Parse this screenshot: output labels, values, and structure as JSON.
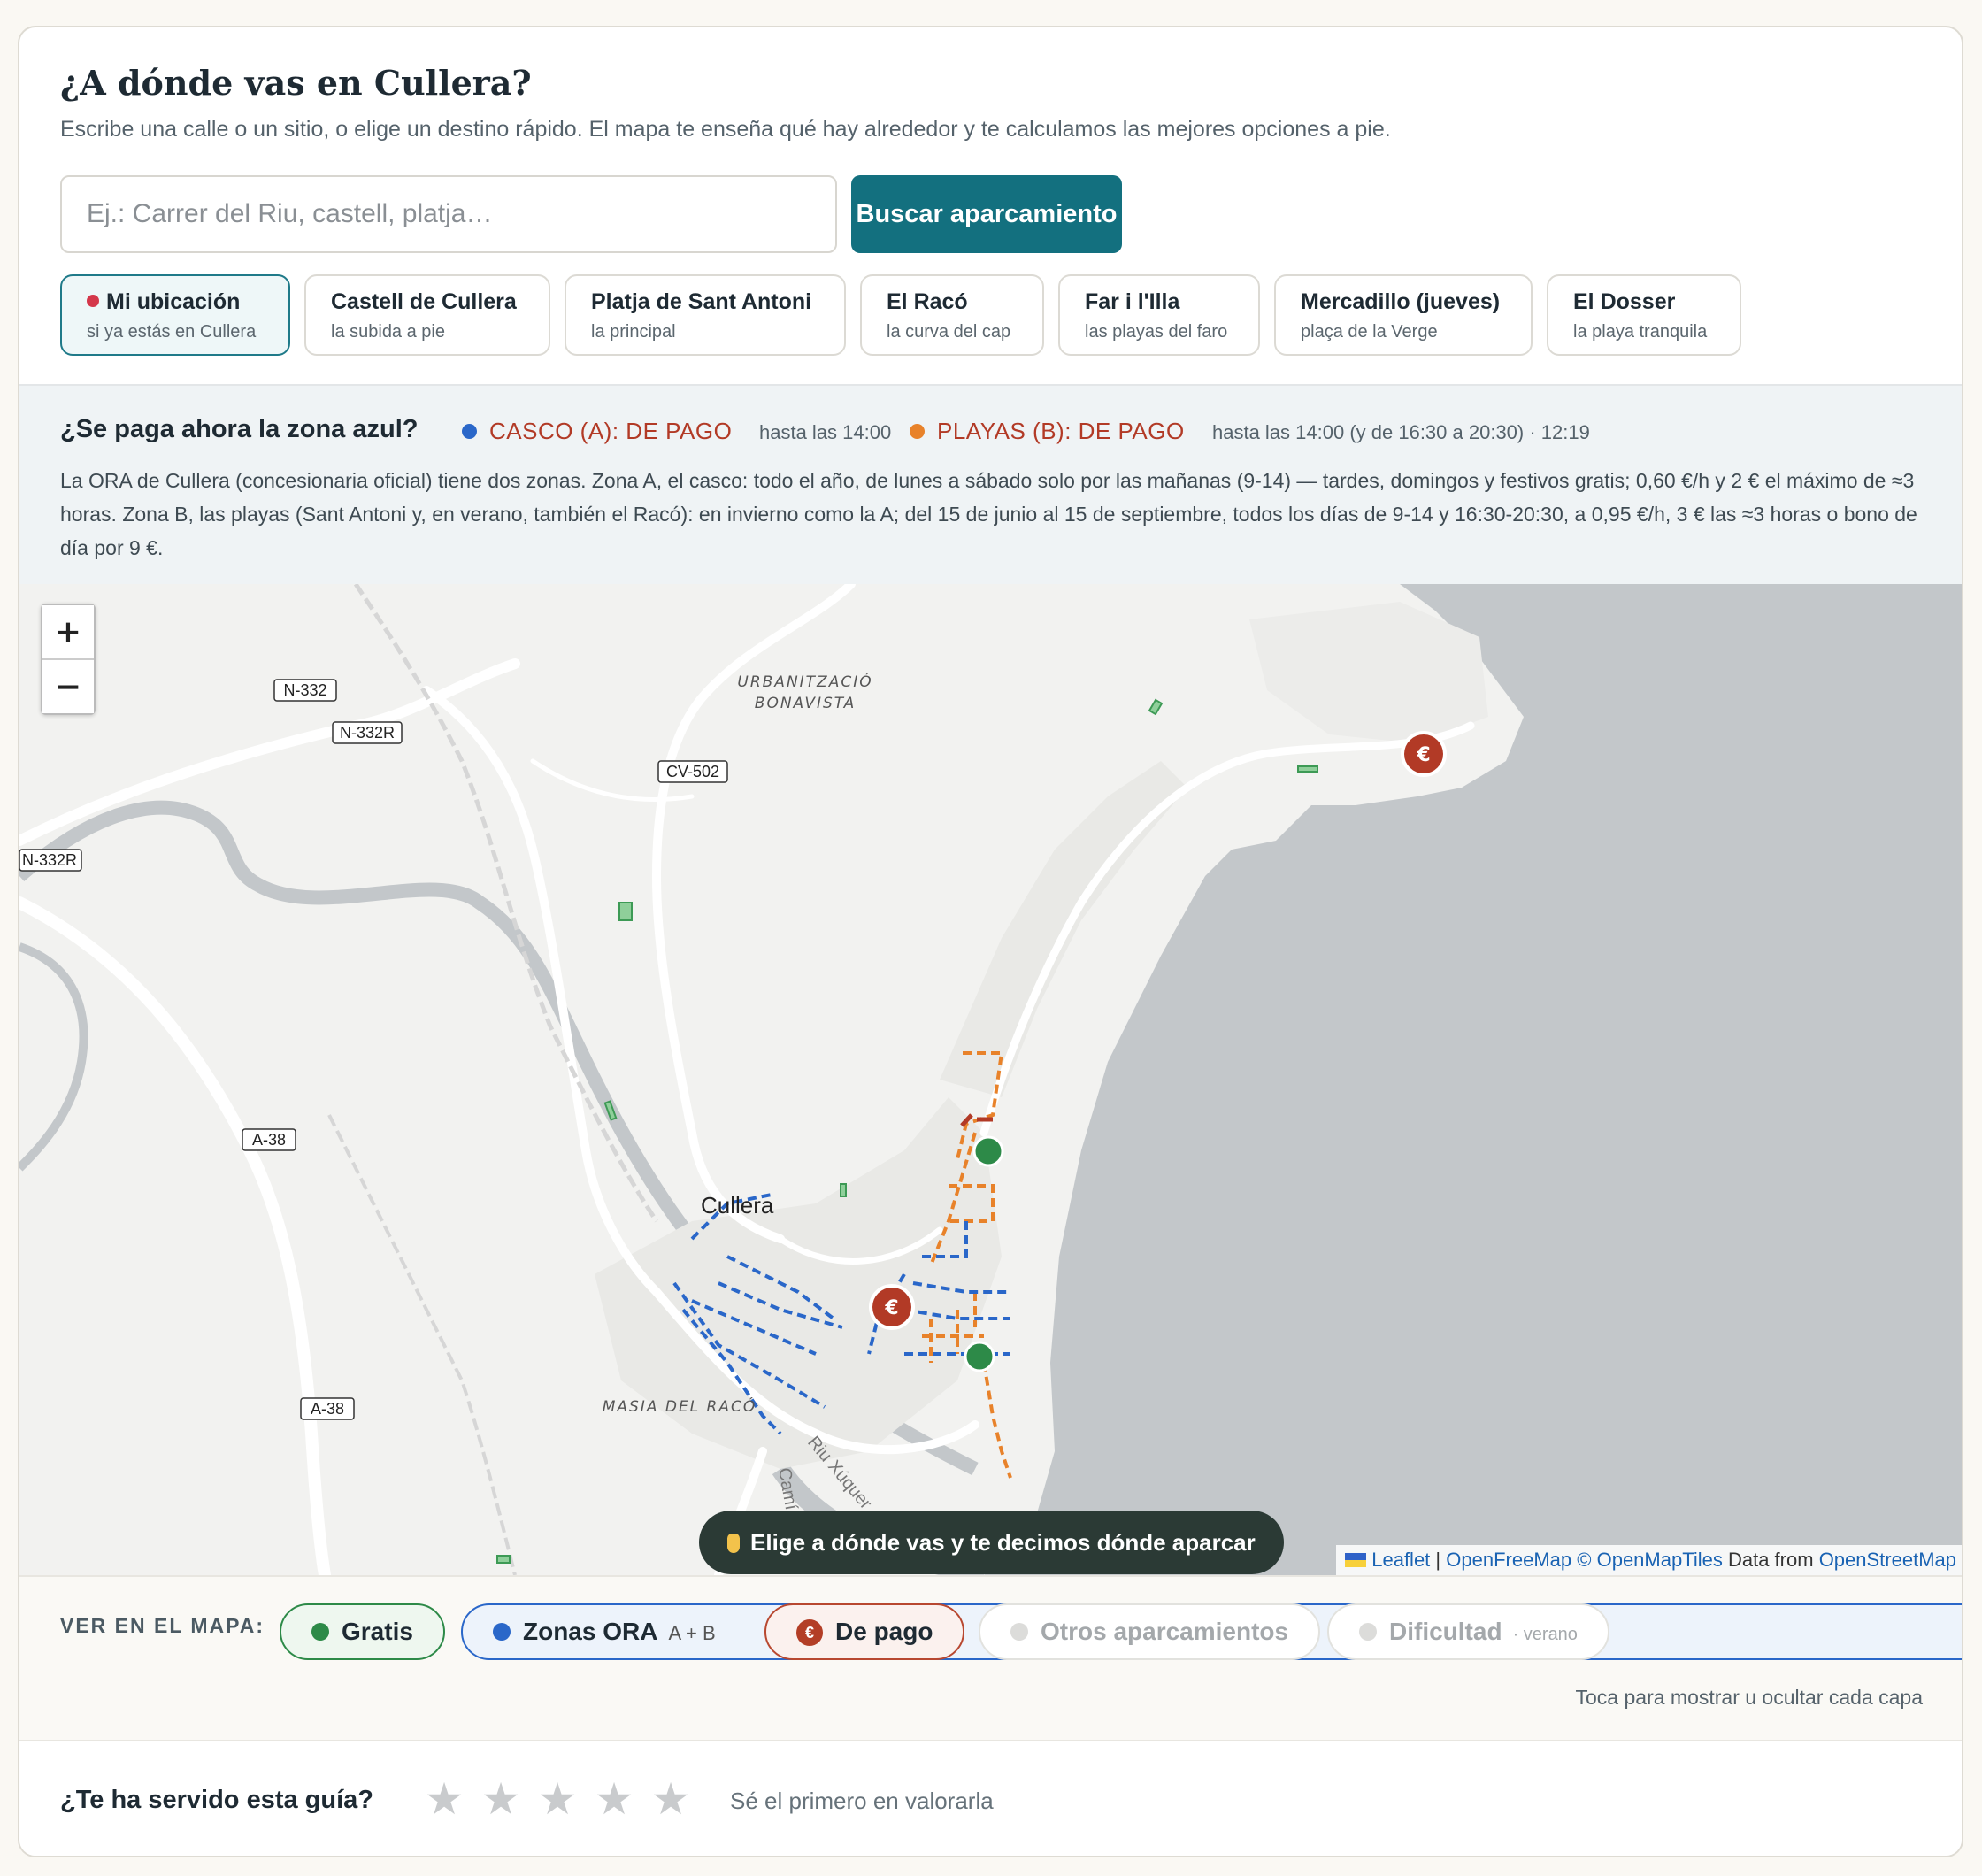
{
  "header": {
    "title": "¿A dónde vas en Cullera?",
    "subtitle": "Escribe una calle o un sitio, o elige un destino rápido. El mapa te enseña qué hay alrededor y te calculamos las mejores opciones a pie.",
    "search_placeholder": "Ej.: Carrer del Riu, castell, platja…",
    "search_value": "",
    "search_button": "Buscar aparcamiento"
  },
  "destinations": [
    {
      "label": "Mi ubicación",
      "sub": "si ya estás en Cullera",
      "icon": "pin-icon"
    },
    {
      "label": "Castell de Cullera",
      "sub": "la subida a pie"
    },
    {
      "label": "Platja de Sant Antoni",
      "sub": "la principal"
    },
    {
      "label": "El Racó",
      "sub": "la curva del cap"
    },
    {
      "label": "Far i l'Illa",
      "sub": "las playas del faro"
    },
    {
      "label": "Mercadillo (jueves)",
      "sub": "plaça de la Verge"
    },
    {
      "label": "El Dosser",
      "sub": "la playa tranquila"
    }
  ],
  "ora": {
    "question": "¿Se paga ahora la zona azul?",
    "zone_a_status": "CASCO (A): DE PAGO",
    "zone_a_time": "hasta las 14:00",
    "zone_b_status": "PLAYAS (B): DE PAGO",
    "zone_b_time": "hasta las 14:00 (y de 16:30 a 20:30) · 12:19",
    "description": "La ORA de Cullera (concesionaria oficial) tiene dos zonas. Zona A, el casco: todo el año, de lunes a sábado solo por las mañanas (9-14) — tardes, domingos y festivos gratis; 0,60 €/h y 2 € el máximo de ≈3 horas. Zona B, las playas (Sant Antoni y, en verano, también el Racó): en invierno como la A; del 15 de junio al 15 de septiembre, todos los días de 9-14 y 16:30-20:30, a 0,95 €/h, 3 € las ≈3 horas o bono de día por 9 €.",
    "colors": {
      "zone_a": "#2a67c9",
      "zone_b": "#e8822a",
      "paid": "#b23a26",
      "free": "#2d8a48"
    }
  },
  "map": {
    "zoom_in": "+",
    "zoom_out": "−",
    "road_labels": [
      "N-332",
      "N-332R",
      "N-332R",
      "CV-502",
      "A-38",
      "A-38"
    ],
    "place_labels": [
      "URBANITZACIÓ",
      "BONAVISTA",
      "Cullera",
      "MASIA DEL RACÓ",
      "Riu Xúquer",
      "Camí"
    ],
    "marker_symbol": "€",
    "hint": "Elige a dónde vas y te decimos dónde aparcar",
    "attribution": {
      "leaflet": "Leaflet",
      "sep": "|",
      "openfreemap": "OpenFreeMap",
      "copy": "©",
      "openmaptiles": "OpenMapTiles",
      "data_from": "Data from",
      "osm": "OpenStreetMap"
    }
  },
  "layers": {
    "label": "VER EN EL MAPA:",
    "free": "Gratis",
    "ora": "Zonas ORA",
    "ora_extra": "A + B",
    "paid": "De pago",
    "paid_symbol": "€",
    "other": "Otros aparcamientos",
    "difficulty": "Dificultad",
    "difficulty_extra": "· verano",
    "hint": "Toca para mostrar u ocultar cada capa"
  },
  "rating": {
    "question": "¿Te ha servido esta guía?",
    "star": "★",
    "note": "Sé el primero en valorarla"
  }
}
